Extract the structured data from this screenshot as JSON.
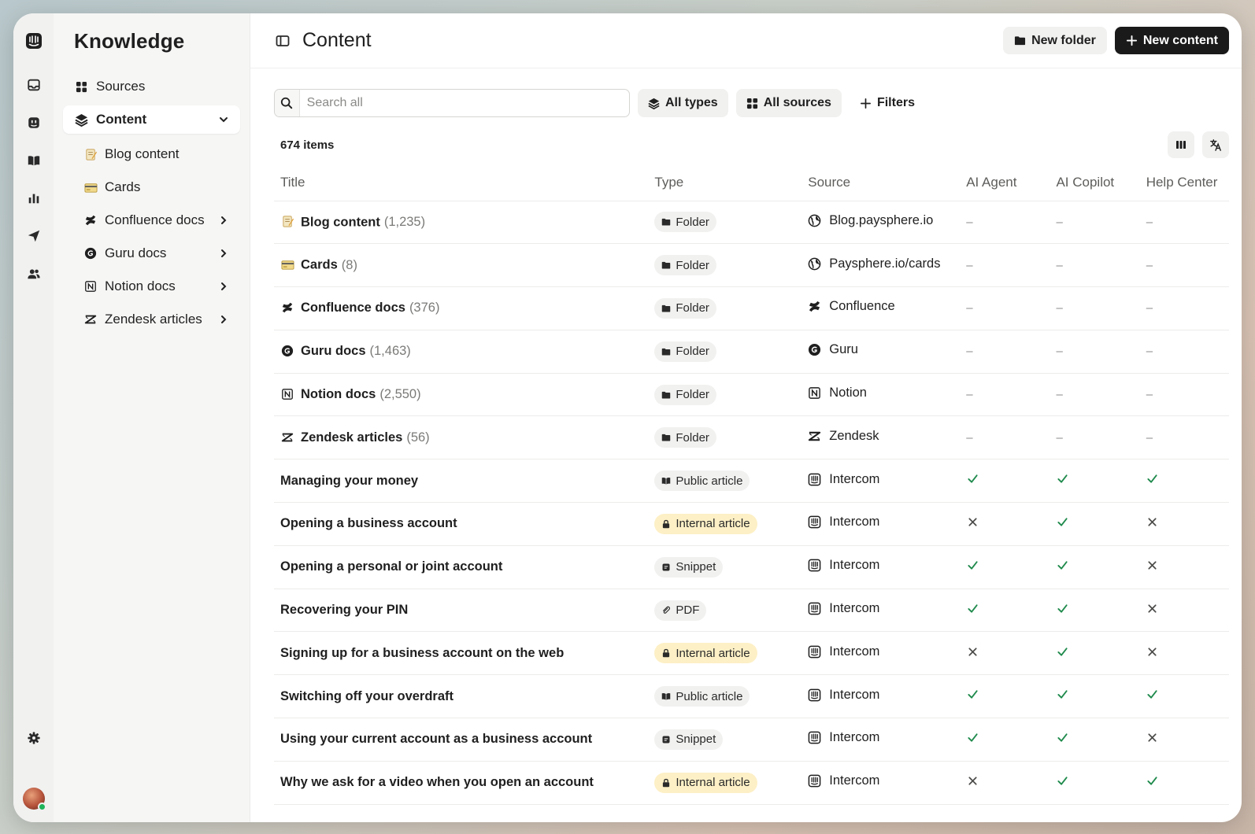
{
  "app": {
    "section_title": "Knowledge",
    "page_title": "Content"
  },
  "rail": {
    "icons": [
      "intercom-logo-icon",
      "inbox-icon",
      "fin-icon",
      "book-icon",
      "reports-icon",
      "outbound-icon",
      "contacts-icon",
      "settings-icon"
    ]
  },
  "sidebar": {
    "sources_label": "Sources",
    "content_label": "Content",
    "sub_items": [
      {
        "label": "Blog content",
        "icon": "memo-emoji-icon",
        "has_children": false
      },
      {
        "label": "Cards",
        "icon": "credit-card-emoji-icon",
        "has_children": false
      },
      {
        "label": "Confluence docs",
        "icon": "confluence-icon",
        "has_children": true
      },
      {
        "label": "Guru docs",
        "icon": "guru-icon",
        "has_children": true
      },
      {
        "label": "Notion docs",
        "icon": "notion-icon",
        "has_children": true
      },
      {
        "label": "Zendesk articles",
        "icon": "zendesk-icon",
        "has_children": true
      }
    ]
  },
  "toolbar": {
    "new_folder_label": "New folder",
    "new_content_label": "New content"
  },
  "filters": {
    "search_placeholder": "Search all",
    "all_types_label": "All types",
    "all_sources_label": "All sources",
    "filters_label": "Filters"
  },
  "list": {
    "count_label": "674 items",
    "columns": {
      "title": "Title",
      "type": "Type",
      "source": "Source",
      "ai_agent": "AI Agent",
      "ai_copilot": "AI Copilot",
      "help_center": "Help Center"
    },
    "rows": [
      {
        "title": "Blog content",
        "count": "(1,235)",
        "title_icon": "memo-emoji-icon",
        "type": "Folder",
        "type_kind": "folder",
        "source": "Blog.paysphere.io",
        "source_icon": "globe-icon",
        "ai_agent": "–",
        "ai_copilot": "–",
        "help_center": "–"
      },
      {
        "title": "Cards",
        "count": "(8)",
        "title_icon": "credit-card-emoji-icon",
        "type": "Folder",
        "type_kind": "folder",
        "source": "Paysphere.io/cards",
        "source_icon": "globe-icon",
        "ai_agent": "–",
        "ai_copilot": "–",
        "help_center": "–"
      },
      {
        "title": "Confluence docs",
        "count": "(376)",
        "title_icon": "confluence-icon",
        "type": "Folder",
        "type_kind": "folder",
        "source": "Confluence",
        "source_icon": "confluence-icon",
        "ai_agent": "–",
        "ai_copilot": "–",
        "help_center": "–"
      },
      {
        "title": "Guru docs",
        "count": "(1,463)",
        "title_icon": "guru-icon",
        "type": "Folder",
        "type_kind": "folder",
        "source": "Guru",
        "source_icon": "guru-icon",
        "ai_agent": "–",
        "ai_copilot": "–",
        "help_center": "–"
      },
      {
        "title": "Notion docs",
        "count": "(2,550)",
        "title_icon": "notion-icon",
        "type": "Folder",
        "type_kind": "folder",
        "source": "Notion",
        "source_icon": "notion-icon",
        "ai_agent": "–",
        "ai_copilot": "–",
        "help_center": "–"
      },
      {
        "title": "Zendesk articles",
        "count": "(56)",
        "title_icon": "zendesk-icon",
        "type": "Folder",
        "type_kind": "folder",
        "source": "Zendesk",
        "source_icon": "zendesk-icon",
        "ai_agent": "–",
        "ai_copilot": "–",
        "help_center": "–"
      },
      {
        "title": "Managing your money",
        "count": "",
        "title_icon": "",
        "type": "Public article",
        "type_kind": "public",
        "source": "Intercom",
        "source_icon": "intercom-icon",
        "ai_agent": "check",
        "ai_copilot": "check",
        "help_center": "check"
      },
      {
        "title": "Opening a business account",
        "count": "",
        "title_icon": "",
        "type": "Internal article",
        "type_kind": "internal",
        "source": "Intercom",
        "source_icon": "intercom-icon",
        "ai_agent": "cross",
        "ai_copilot": "check",
        "help_center": "cross"
      },
      {
        "title": "Opening a personal or joint account",
        "count": "",
        "title_icon": "",
        "type": "Snippet",
        "type_kind": "snippet",
        "source": "Intercom",
        "source_icon": "intercom-icon",
        "ai_agent": "check",
        "ai_copilot": "check",
        "help_center": "cross"
      },
      {
        "title": "Recovering your PIN",
        "count": "",
        "title_icon": "",
        "type": "PDF",
        "type_kind": "pdf",
        "source": "Intercom",
        "source_icon": "intercom-icon",
        "ai_agent": "check",
        "ai_copilot": "check",
        "help_center": "cross"
      },
      {
        "title": "Signing up for a business account on the web",
        "count": "",
        "title_icon": "",
        "type": "Internal article",
        "type_kind": "internal",
        "source": "Intercom",
        "source_icon": "intercom-icon",
        "ai_agent": "cross",
        "ai_copilot": "check",
        "help_center": "cross"
      },
      {
        "title": "Switching off your overdraft",
        "count": "",
        "title_icon": "",
        "type": "Public article",
        "type_kind": "public",
        "source": "Intercom",
        "source_icon": "intercom-icon",
        "ai_agent": "check",
        "ai_copilot": "check",
        "help_center": "check"
      },
      {
        "title": "Using your current account as a business account",
        "count": "",
        "title_icon": "",
        "type": "Snippet",
        "type_kind": "snippet",
        "source": "Intercom",
        "source_icon": "intercom-icon",
        "ai_agent": "check",
        "ai_copilot": "check",
        "help_center": "cross"
      },
      {
        "title": "Why we ask for a video when you open an account",
        "count": "",
        "title_icon": "",
        "type": "Internal article",
        "type_kind": "internal",
        "source": "Intercom",
        "source_icon": "intercom-icon",
        "ai_agent": "cross",
        "ai_copilot": "check",
        "help_center": "check"
      }
    ]
  },
  "colors": {
    "check": "#1f8a4c",
    "cross": "#4a4a48",
    "internal_pill": "#fdf0c6",
    "dark_button": "#1a1a1a"
  }
}
